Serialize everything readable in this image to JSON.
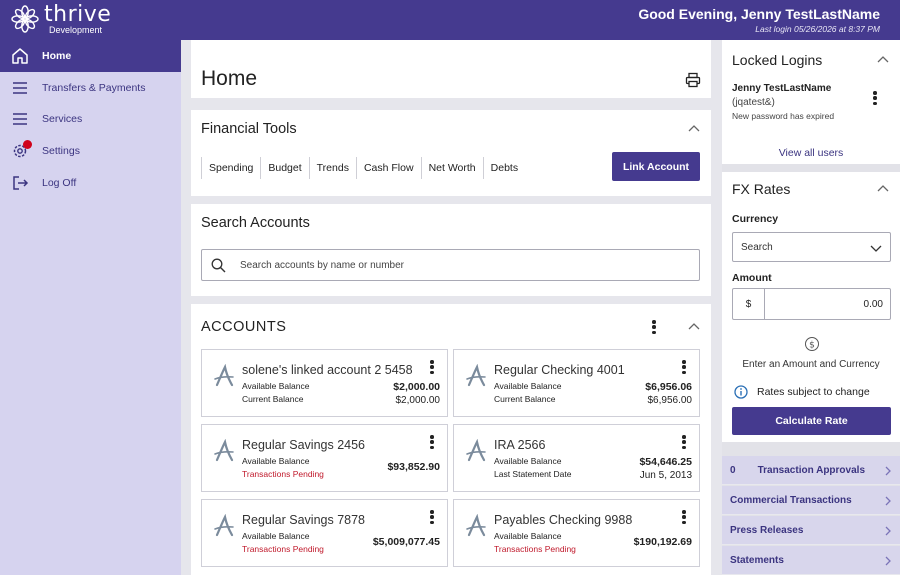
{
  "header": {
    "brand_name": "thrive",
    "brand_sub": "Development",
    "greeting": "Good Evening, Jenny TestLastName",
    "last_login": "Last login 05/26/2026 at 8:37 PM"
  },
  "sidebar": {
    "items": [
      {
        "label": "Home",
        "icon": "home-icon"
      },
      {
        "label": "Transfers & Payments",
        "icon": "menu-icon"
      },
      {
        "label": "Services",
        "icon": "menu-icon"
      },
      {
        "label": "Settings",
        "icon": "gear-icon"
      },
      {
        "label": "Log Off",
        "icon": "logout-icon"
      }
    ]
  },
  "main": {
    "page_title": "Home",
    "financial_tools": {
      "title": "Financial Tools",
      "tools": [
        "Spending",
        "Budget",
        "Trends",
        "Cash Flow",
        "Net Worth",
        "Debts"
      ],
      "link_button": "Link Account"
    },
    "search": {
      "title": "Search Accounts",
      "placeholder": "Search accounts by name or number"
    },
    "accounts": {
      "title": "ACCOUNTS",
      "tiles": [
        {
          "name": "solene's linked account 2 5458",
          "line1": "Available Balance",
          "value1": "$2,000.00",
          "line2": "Current Balance",
          "value2": "$2,000.00"
        },
        {
          "name": "Regular Checking 4001",
          "line1": "Available Balance",
          "value1": "$6,956.06",
          "line2": "Current Balance",
          "value2": "$6,956.00"
        },
        {
          "name": "Regular Savings 2456",
          "line1": "Available Balance",
          "value1": "$93,852.90",
          "line2": "Transactions Pending",
          "value2": ""
        },
        {
          "name": "IRA 2566",
          "line1": "Available Balance",
          "value1": "$54,646.25",
          "line2": "Last Statement Date",
          "value2": "Jun 5, 2013"
        },
        {
          "name": "Regular Savings 7878",
          "line1": "Available Balance",
          "value1": "$5,009,077.45",
          "line2": "Transactions Pending",
          "value2": ""
        },
        {
          "name": "Payables Checking 9988",
          "line1": "Available Balance",
          "value1": "$190,192.69",
          "line2": "Transactions Pending",
          "value2": ""
        }
      ]
    }
  },
  "right": {
    "locked": {
      "title": "Locked Logins",
      "name": "Jenny TestLastName",
      "user": "(jqatest&)",
      "note": "New password has expired",
      "view_all": "View all users"
    },
    "fx": {
      "title": "FX Rates",
      "currency_label": "Currency",
      "currency_value": "Search",
      "amount_label": "Amount",
      "amount_symbol": "$",
      "amount_value": "0.00",
      "hint": "Enter an Amount and Currency",
      "note": "Rates subject to change",
      "button": "Calculate Rate"
    },
    "links": [
      {
        "count": "0",
        "label": "Transaction Approvals"
      },
      {
        "count": "",
        "label": "Commercial Transactions"
      },
      {
        "count": "",
        "label": "Press Releases"
      },
      {
        "count": "",
        "label": "Statements"
      }
    ]
  },
  "colors": {
    "brand": "#453a8f",
    "sidebar_bg": "#d6d3ef",
    "pending": "#c0192b"
  }
}
